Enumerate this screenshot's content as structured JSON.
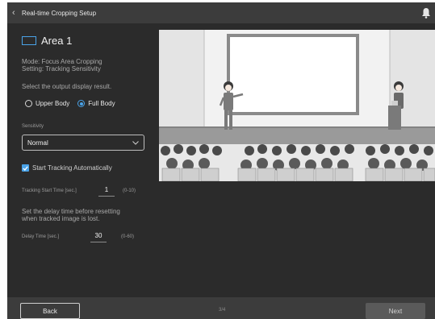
{
  "header": {
    "title": "Real-time Cropping Setup",
    "back_icon": "chevron-left-icon",
    "notification_icon": "bell-icon"
  },
  "panel": {
    "area_title": "Area 1",
    "mode_line1": "Mode: Focus Area Cropping",
    "mode_line2": "Setting: Tracking Sensitivity",
    "select_prompt": "Select the output display result.",
    "radio_options": [
      {
        "label": "Upper Body",
        "selected": false
      },
      {
        "label": "Full Body",
        "selected": true
      }
    ],
    "sensitivity_label": "Sensitivity",
    "sensitivity_value": "Normal",
    "auto_tracking_label": "Start Tracking Automatically",
    "auto_tracking_checked": true,
    "tracking_start_label": "Tracking Start Time [sec.]",
    "tracking_start_value": "1",
    "tracking_start_range": "(0-10)",
    "delay_text_line1": "Set the delay time before resetting",
    "delay_text_line2": "when tracked image is lost.",
    "delay_label": "Delay Time [sec.]",
    "delay_value": "30",
    "delay_range": "(0-60)"
  },
  "preview": {
    "image": "lecture-hall-illustration"
  },
  "footer": {
    "back_label": "Back",
    "page_indicator": "3/4",
    "next_label": "Next"
  },
  "colors": {
    "accent": "#4aa3e8",
    "background": "#2b2b2b",
    "bar": "#3c3c3c"
  }
}
